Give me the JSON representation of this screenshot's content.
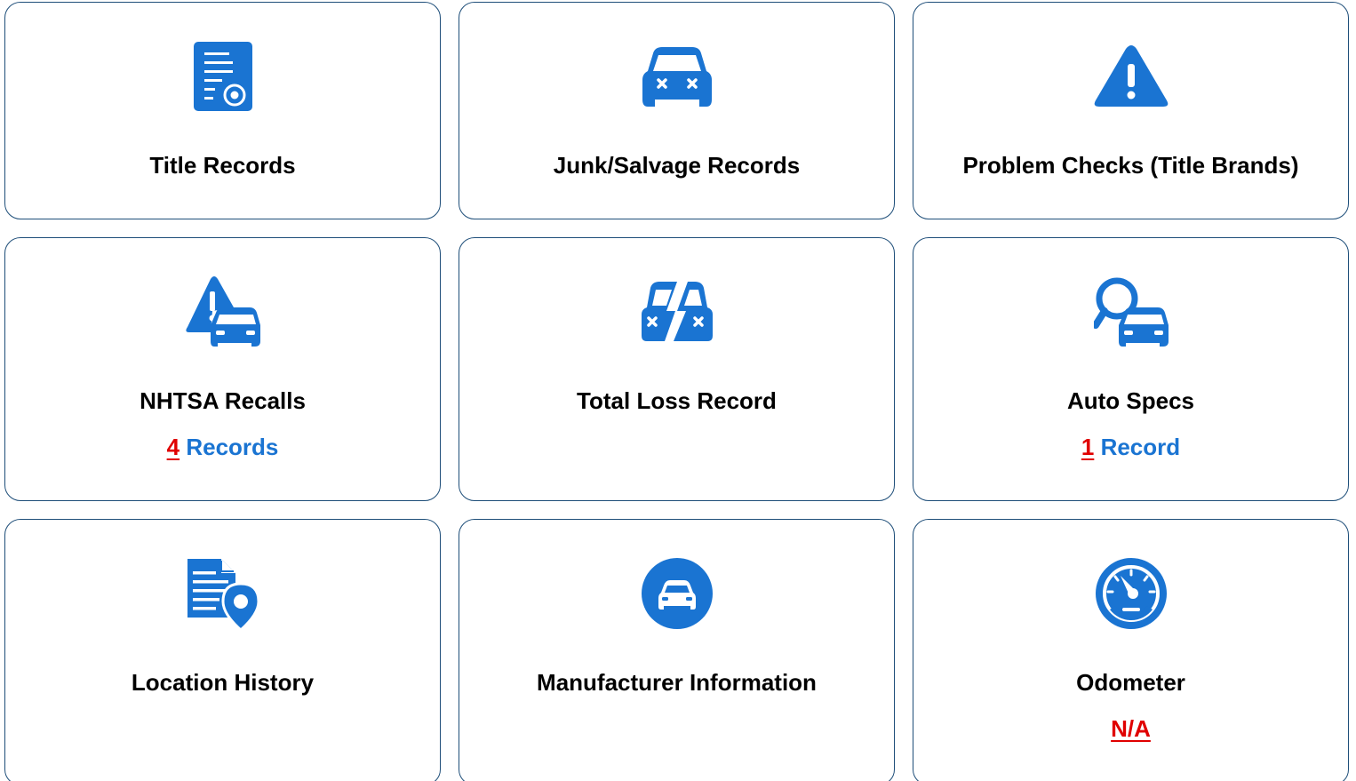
{
  "colors": {
    "icon_blue": "#1a74d2",
    "border": "#1e4e79",
    "count_red": "#e00000",
    "label_blue": "#1a74d2"
  },
  "cards": [
    {
      "title": "Title Records",
      "icon": "document-seal-icon"
    },
    {
      "title": "Junk/Salvage Records",
      "icon": "wrecked-car-icon"
    },
    {
      "title": "Problem Checks (Title Brands)",
      "icon": "warning-triangle-icon"
    },
    {
      "title": "NHTSA Recalls",
      "icon": "recall-car-icon",
      "count": "4",
      "count_label": "Records"
    },
    {
      "title": "Total Loss Record",
      "icon": "split-wrecked-car-icon"
    },
    {
      "title": "Auto Specs",
      "icon": "search-car-icon",
      "count": "1",
      "count_label": "Record"
    },
    {
      "title": "Location History",
      "icon": "document-location-icon"
    },
    {
      "title": "Manufacturer Information",
      "icon": "car-circle-icon"
    },
    {
      "title": "Odometer",
      "icon": "speedometer-icon",
      "value": "N/A"
    }
  ]
}
